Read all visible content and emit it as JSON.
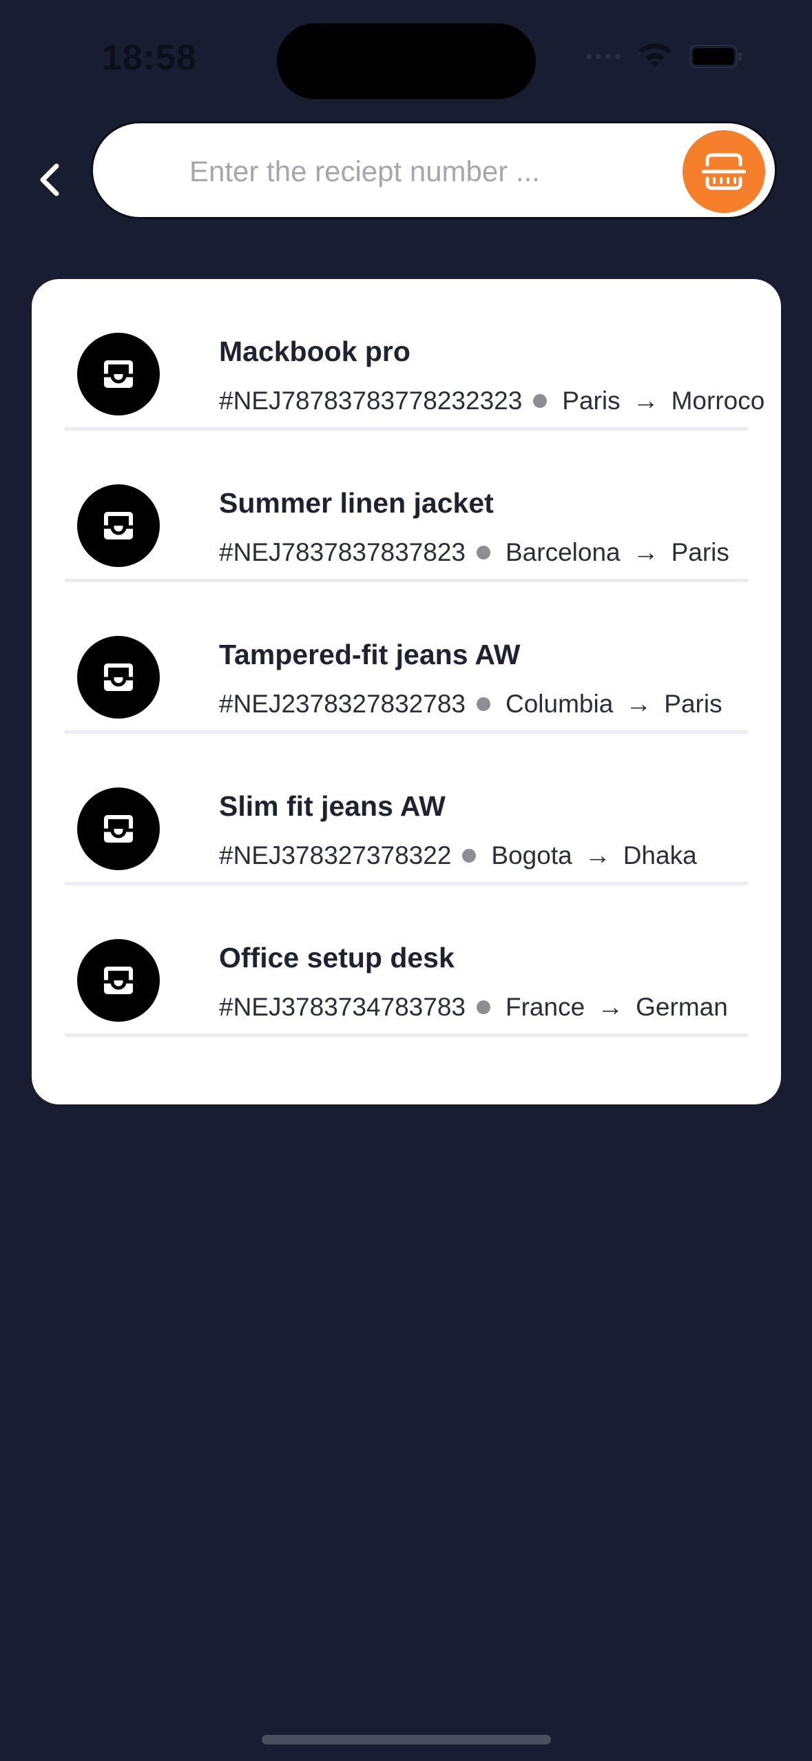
{
  "status_bar": {
    "time": "18:58"
  },
  "search": {
    "placeholder": "Enter the reciept number ..."
  },
  "colors": {
    "background": "#191d31",
    "accent": "#f57f2a",
    "card": "#ffffff"
  },
  "icons": {
    "back": "chevron-left-icon",
    "scan": "scan-icon",
    "package": "package-box-icon"
  },
  "packages": [
    {
      "title": "Mackbook pro",
      "receipt": "#NEJ78783783778232323",
      "from": "Paris",
      "to": "Morroco"
    },
    {
      "title": "Summer linen jacket",
      "receipt": "#NEJ7837837837823",
      "from": "Barcelona",
      "to": "Paris"
    },
    {
      "title": "Tampered-fit jeans AW",
      "receipt": "#NEJ2378327832783",
      "from": "Columbia",
      "to": "Paris"
    },
    {
      "title": "Slim fit jeans AW",
      "receipt": "#NEJ378327378322",
      "from": "Bogota",
      "to": "Dhaka"
    },
    {
      "title": "Office setup desk",
      "receipt": "#NEJ3783734783783",
      "from": "France",
      "to": "German"
    }
  ]
}
